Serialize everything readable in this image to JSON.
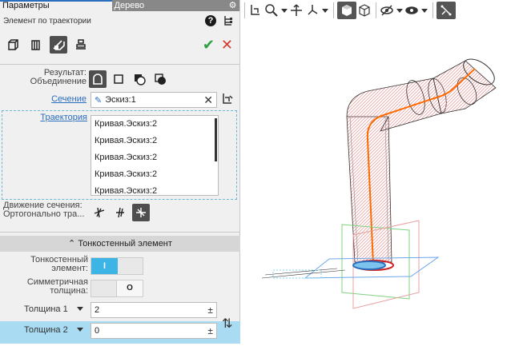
{
  "tabs": {
    "params": "Параметры",
    "tree": "Дерево"
  },
  "header": {
    "title": "Элемент по траектории"
  },
  "result": {
    "label": "Результат:\nОбъединение"
  },
  "section": {
    "label": "Сечение",
    "value": "Эскиз:1"
  },
  "trajectory": {
    "label": "Траектория",
    "items": [
      "Кривая.Эскиз:2",
      "Кривая.Эскиз:2",
      "Кривая.Эскиз:2",
      "Кривая.Эскиз:2",
      "Кривая.Эскиз:2"
    ]
  },
  "motion": {
    "label": "Движение сечения:\nОртогонально тра..."
  },
  "thin_section": {
    "header": "Тонкостенный элемент"
  },
  "thin_toggle": {
    "label": "Тонкостенный\nэлемент:",
    "on": "I",
    "off": "O"
  },
  "symmetric": {
    "label": "Симметричная\nтолщина:",
    "off": "O"
  },
  "thickness1": {
    "label": "Толщина 1",
    "value": "2",
    "pm": "±"
  },
  "thickness2": {
    "label": "Толщина 2",
    "value": "0",
    "pm": "±"
  },
  "colors": {
    "accent": "#3cb4e6",
    "link": "#2a6ebd",
    "ok": "#2ea043",
    "cancel": "#d43b2f",
    "path": "#ff6a00",
    "pink_hatch": "#e89090"
  }
}
